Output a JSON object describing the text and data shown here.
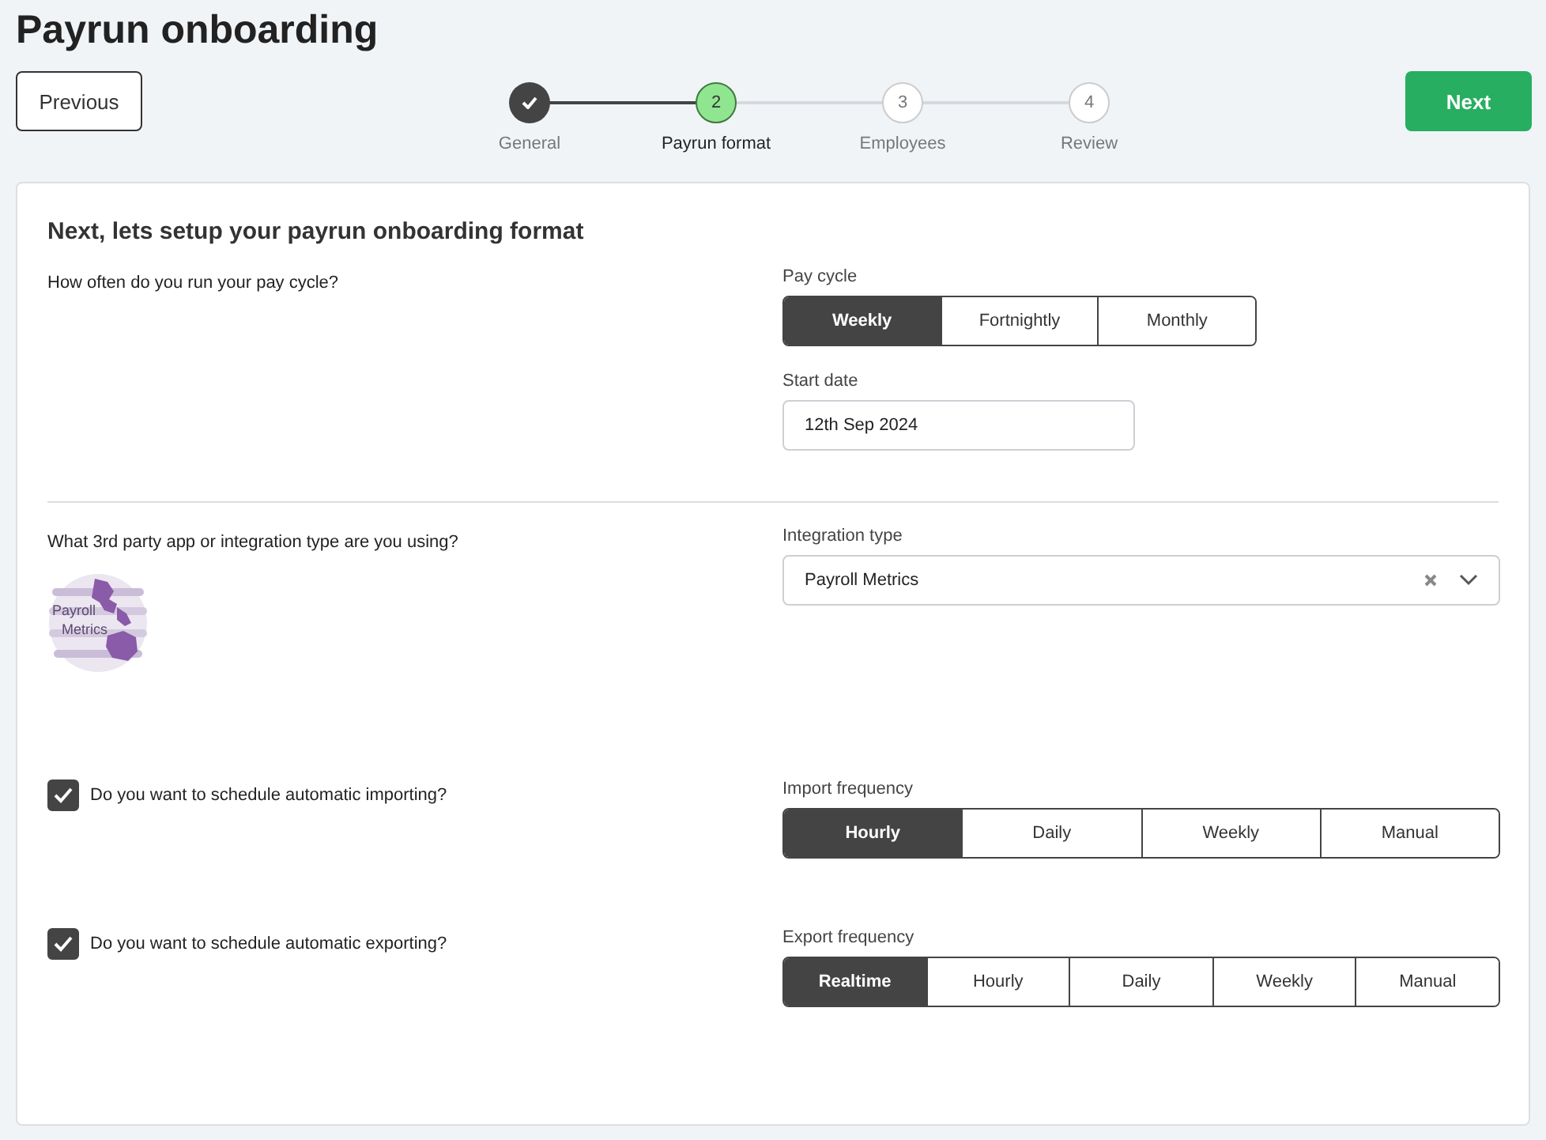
{
  "title": "Payrun onboarding",
  "previous_button": "Previous",
  "next_button": "Next",
  "steps": [
    {
      "label": "General",
      "done": true,
      "selected": false
    },
    {
      "number": "2",
      "label": "Payrun format",
      "done": false,
      "selected": true
    },
    {
      "number": "3",
      "label": "Employees",
      "done": false,
      "selected": false
    },
    {
      "number": "4",
      "label": "Review",
      "done": false,
      "selected": false
    }
  ],
  "heading": "Next, lets setup your payrun onboarding format",
  "pay_cycle_section": {
    "question": "How often do you run your pay cycle?",
    "pay_cycle": {
      "label": "Pay cycle",
      "options": [
        {
          "label": "Weekly",
          "selected": true
        },
        {
          "label": "Fortnightly",
          "selected": false
        },
        {
          "label": "Monthly",
          "selected": false
        }
      ]
    },
    "start_date": {
      "label": "Start date",
      "value": "12th Sep 2024"
    }
  },
  "integration_section": {
    "question": "What 3rd party app or integration type are you using?",
    "logo_lines": [
      "Payroll",
      "Metrics"
    ],
    "integration_type": {
      "label": "Integration type",
      "value": "Payroll Metrics"
    }
  },
  "schedules": [
    {
      "question": "Do you want to schedule automatic importing?",
      "checked": true,
      "label": "Import frequency",
      "options": [
        {
          "label": "Hourly",
          "selected": true
        },
        {
          "label": "Daily",
          "selected": false
        },
        {
          "label": "Weekly",
          "selected": false
        },
        {
          "label": "Manual",
          "selected": false
        }
      ]
    },
    {
      "question": "Do you want to schedule automatic exporting?",
      "checked": true,
      "label": "Export frequency",
      "options": [
        {
          "label": "Realtime",
          "selected": true
        },
        {
          "label": "Hourly",
          "selected": false
        },
        {
          "label": "Daily",
          "selected": false
        },
        {
          "label": "Weekly",
          "selected": false
        },
        {
          "label": "Manual",
          "selected": false
        }
      ]
    }
  ]
}
